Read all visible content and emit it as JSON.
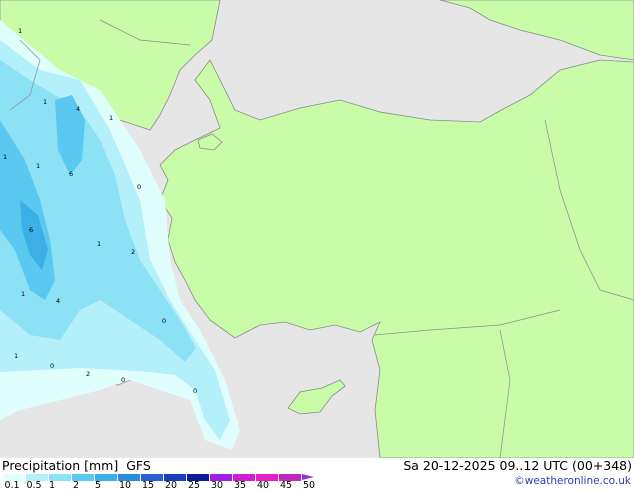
{
  "footer": {
    "title": "Precipitation [mm]",
    "model": "GFS",
    "datetime": "Sa 20-12-2025 09..12 UTC (00+348)",
    "credit": "©weatheronline.co.uk"
  },
  "legend": {
    "ticks": [
      "0.1",
      "0.5",
      "1",
      "2",
      "5",
      "10",
      "15",
      "20",
      "25",
      "30",
      "35",
      "40",
      "45",
      "50"
    ],
    "colors": [
      "#e0ffff",
      "#b4f0fa",
      "#8ce1f5",
      "#5ac8f0",
      "#3cafe6",
      "#2d8cdc",
      "#2a5fd2",
      "#1e3cbe",
      "#0a1e96",
      "#a01ee6",
      "#d21ed2",
      "#e61ec8",
      "#be28be",
      "#9a2be0"
    ],
    "arrow_color": "#9a2be0"
  },
  "map": {
    "colors": {
      "land": "#c8fca8",
      "sea": "#e6e6e6",
      "border": "#8c8c8c"
    },
    "point_values": [
      "1",
      "1",
      "4",
      "1",
      "1",
      "6",
      "0",
      "1",
      "6",
      "1",
      "2",
      "1",
      "4",
      "0",
      "1",
      "0",
      "2",
      "0",
      "0"
    ]
  }
}
